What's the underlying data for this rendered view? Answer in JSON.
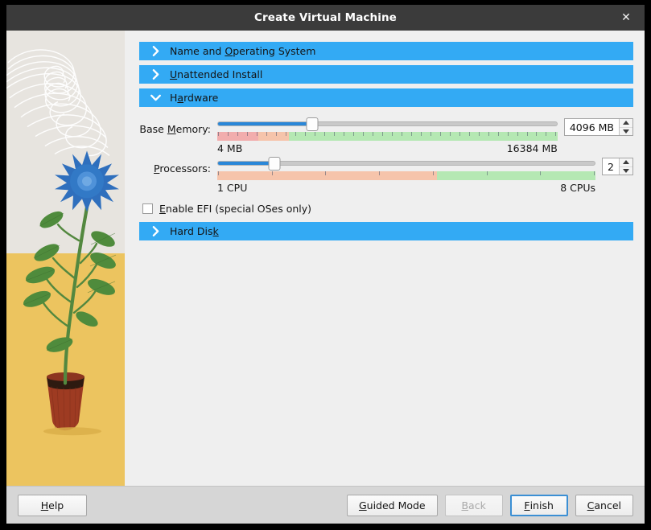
{
  "window": {
    "title": "Create Virtual Machine",
    "close_label": "✕"
  },
  "sections": [
    {
      "id": "name-os",
      "label_before": "Name and ",
      "accel": "O",
      "label_after": "perating System",
      "expanded": false,
      "chevron": "chevron-right-icon"
    },
    {
      "id": "unattended",
      "label_before": "",
      "accel": "U",
      "label_after": "nattended Install",
      "expanded": false,
      "chevron": "chevron-right-icon"
    },
    {
      "id": "hardware",
      "label_before": "H",
      "accel": "a",
      "label_after": "rdware",
      "expanded": true,
      "chevron": "chevron-down-icon"
    },
    {
      "id": "hard-disk",
      "label_before": "Hard Dis",
      "accel": "k",
      "label_after": "",
      "expanded": false,
      "chevron": "chevron-right-icon"
    }
  ],
  "hardware": {
    "memory": {
      "label_before": "Base ",
      "accel": "M",
      "label_after": "emory:",
      "value": "4096 MB",
      "min_label": "4 MB",
      "max_label": "16384 MB",
      "min": 4,
      "max": 16384,
      "current": 4096,
      "handle_percent": 28,
      "zones": [
        {
          "name": "optimal",
          "color": "#b5e8b3",
          "percent": 79
        },
        {
          "name": "warning",
          "color": "#f6c4ab",
          "percent": 9
        },
        {
          "name": "danger",
          "color": "#f2adad",
          "percent": 12
        }
      ],
      "tick_count": 36
    },
    "processors": {
      "label_before": "",
      "accel": "P",
      "label_after": "rocessors:",
      "value": "2",
      "min_label": "1 CPU",
      "max_label": "8 CPUs",
      "min": 1,
      "max": 8,
      "current": 2,
      "handle_percent": 15,
      "zones": [
        {
          "name": "optimal",
          "color": "#b5e8b3",
          "percent": 42
        },
        {
          "name": "warning",
          "color": "#f6c4ab",
          "percent": 58
        }
      ],
      "tick_count": 8
    },
    "efi": {
      "label_before": "",
      "accel": "E",
      "label_after": "nable EFI (special OSes only)",
      "checked": false
    }
  },
  "buttons": {
    "help": {
      "before": "",
      "accel": "H",
      "after": "elp",
      "state": "normal"
    },
    "guided": {
      "before": "",
      "accel": "G",
      "after": "uided Mode",
      "state": "normal"
    },
    "back": {
      "before": "",
      "accel": "B",
      "after": "ack",
      "state": "disabled"
    },
    "finish": {
      "before": "",
      "accel": "F",
      "after": "inish",
      "state": "default"
    },
    "cancel": {
      "before": "",
      "accel": "C",
      "after": "ancel",
      "state": "normal"
    }
  },
  "illustration": {
    "name": "plant-in-pot-illustration",
    "sky_color": "#e7e4df",
    "ground_color": "#ecc45f",
    "flower_color": "#3279c6",
    "stem_color": "#53883f",
    "pot_color": "#9e3b22"
  }
}
